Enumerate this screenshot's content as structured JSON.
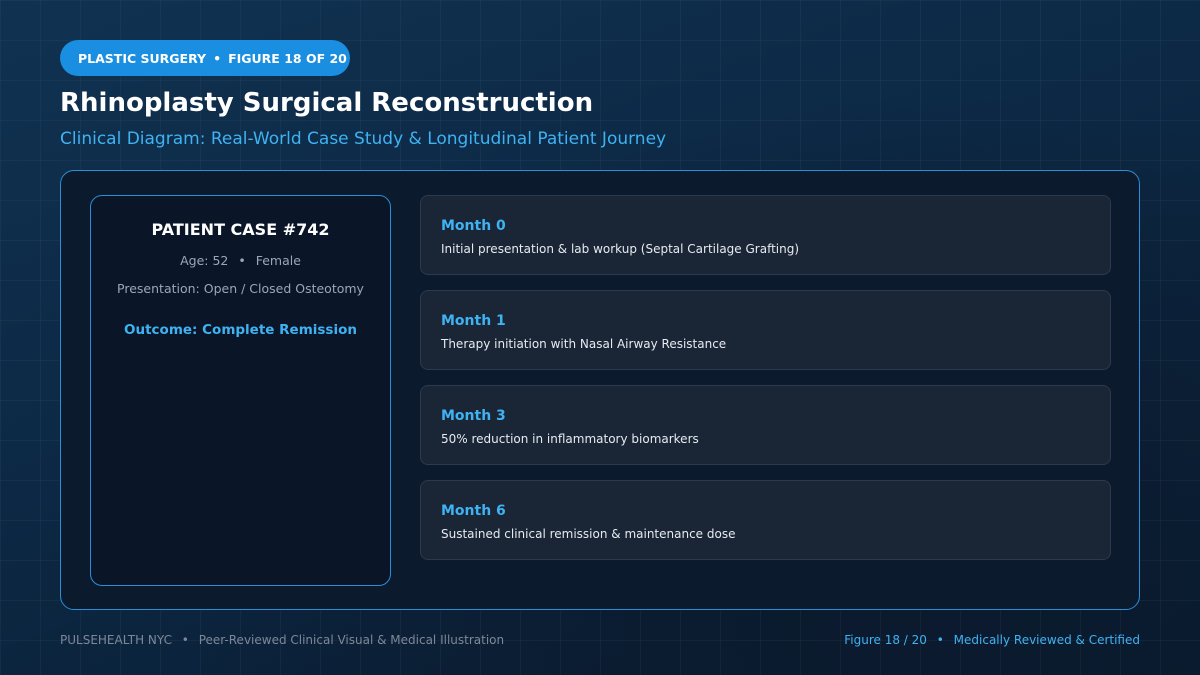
{
  "header": {
    "badge_category": "PLASTIC SURGERY",
    "badge_separator": "•",
    "badge_figure": "FIGURE 18 OF 20",
    "title": "Rhinoplasty Surgical Reconstruction",
    "subtitle": "Clinical Diagram: Real-World Case Study & Longitudinal Patient Journey"
  },
  "case": {
    "title": "PATIENT CASE #742",
    "age": "Age: 52",
    "separator": "•",
    "sex": "Female",
    "presentation": "Presentation: Open / Closed Osteotomy",
    "outcome": "Outcome: Complete Remission"
  },
  "timeline": [
    {
      "label": "Month 0",
      "description": "Initial presentation & lab workup (Septal Cartilage Grafting)"
    },
    {
      "label": "Month 1",
      "description": "Therapy initiation with Nasal Airway Resistance"
    },
    {
      "label": "Month 3",
      "description": "50% reduction in inflammatory biomarkers"
    },
    {
      "label": "Month 6",
      "description": "Sustained clinical remission & maintenance dose"
    }
  ],
  "footer": {
    "brand": "PULSEHEALTH NYC",
    "separator": "•",
    "tagline": "Peer-Reviewed Clinical Visual & Medical Illustration",
    "figure": "Figure 18 / 20",
    "certification": "Medically Reviewed & Certified"
  },
  "colors": {
    "accent": "#3fb2f2",
    "badge": "#1a8ee0",
    "border": "#2a8fd6"
  }
}
